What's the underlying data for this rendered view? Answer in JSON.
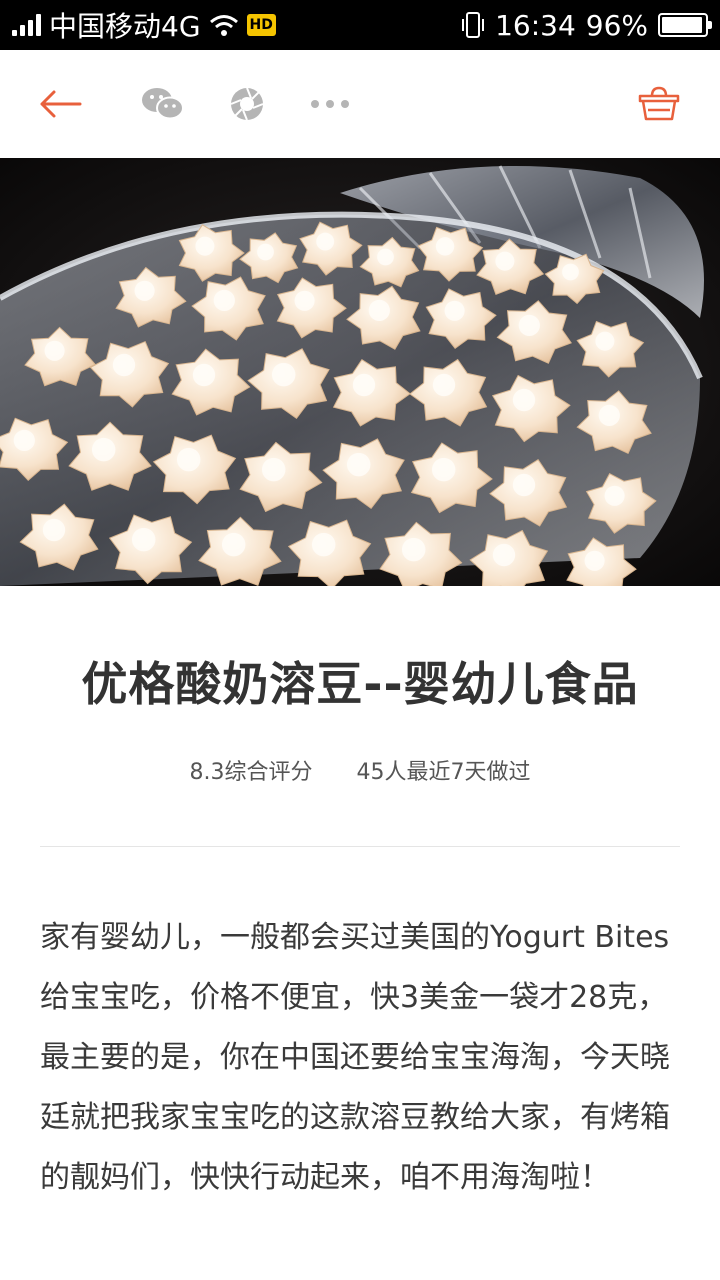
{
  "status_bar": {
    "carrier": "中国移动4G",
    "hd_badge": "HD",
    "time": "16:34",
    "battery": "96%",
    "battery_level": 0.96
  },
  "nav": {
    "back_icon": "arrow-left-icon",
    "share_wechat_icon": "wechat-icon",
    "share_moments_icon": "moments-icon",
    "more_icon": "more-dots-icon",
    "basket_icon": "basket-icon",
    "accent_color": "#e8603c",
    "icon_gray": "#b5b5b5"
  },
  "hero": {
    "image_icon": "yogurt-melts-in-glass-bowl-image"
  },
  "recipe": {
    "title": "优格酸奶溶豆--婴幼儿食品",
    "rating": "8.3综合评分",
    "made_recently": "45人最近7天做过",
    "description": "家有婴幼儿，一般都会买过美国的Yogurt Bites给宝宝吃，价格不便宜，快3美金一袋才28克，最主要的是，你在中国还要给宝宝海淘，今天晓廷就把我家宝宝吃的这款溶豆教给大家，有烤箱的靓妈们，快快行动起来，咱不用海淘啦！"
  }
}
